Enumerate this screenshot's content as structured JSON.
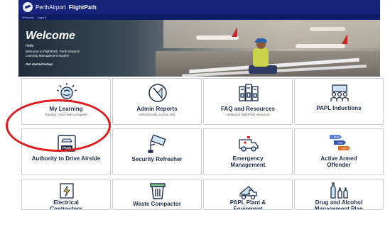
{
  "header": {
    "brand_name": "PerthAirport",
    "app_name": "FlightPath"
  },
  "subnav": {
    "items": [
      "Welcome",
      "Logout"
    ]
  },
  "hero": {
    "title": "Welcome",
    "hello": "Hello",
    "subtitle": "Welcome to FlightPath, Perth Airport's Learning Management System",
    "cta": "Get started today!"
  },
  "tiles": [
    {
      "label": "My Learning",
      "desc": "Training I have been assigned",
      "icon": "brain-icon"
    },
    {
      "label": "Admin Reports",
      "desc": "Administrator access only",
      "icon": "compass-icon"
    },
    {
      "label": "FAQ and Resources",
      "desc": "Additional FlightPath resources",
      "icon": "documents-icon"
    },
    {
      "label": "PAPL Inductions",
      "desc": "",
      "icon": "group-icon"
    },
    {
      "label": "Authority to Drive Airside",
      "desc": "",
      "icon": "pass-icon"
    },
    {
      "label": "Security Refresher",
      "desc": "",
      "icon": "cctv-camera-icon"
    },
    {
      "label": "Emergency Management",
      "desc": "",
      "icon": "ambulance-icon"
    },
    {
      "label": "Active Armed Offender",
      "desc": "",
      "icon": "arrows-icon"
    },
    {
      "label": "Electrical Contractors",
      "desc": "",
      "icon": "electrical-icon"
    },
    {
      "label": "Waste Compactor",
      "desc": "",
      "icon": "bin-icon"
    },
    {
      "label": "PAPL Plant & Equipment",
      "desc": "",
      "icon": "truck-icon"
    },
    {
      "label": "Drug and Alcohol Management Plan",
      "desc": "",
      "icon": "bottles-icon"
    }
  ],
  "pass_badge": "PASS",
  "arrow_tags": [
    "RUN",
    "HIDE",
    "ACT"
  ],
  "colors": {
    "nav": "#16257a",
    "highlight": "#e01a1a",
    "tile_text": "#1c2c4a"
  }
}
